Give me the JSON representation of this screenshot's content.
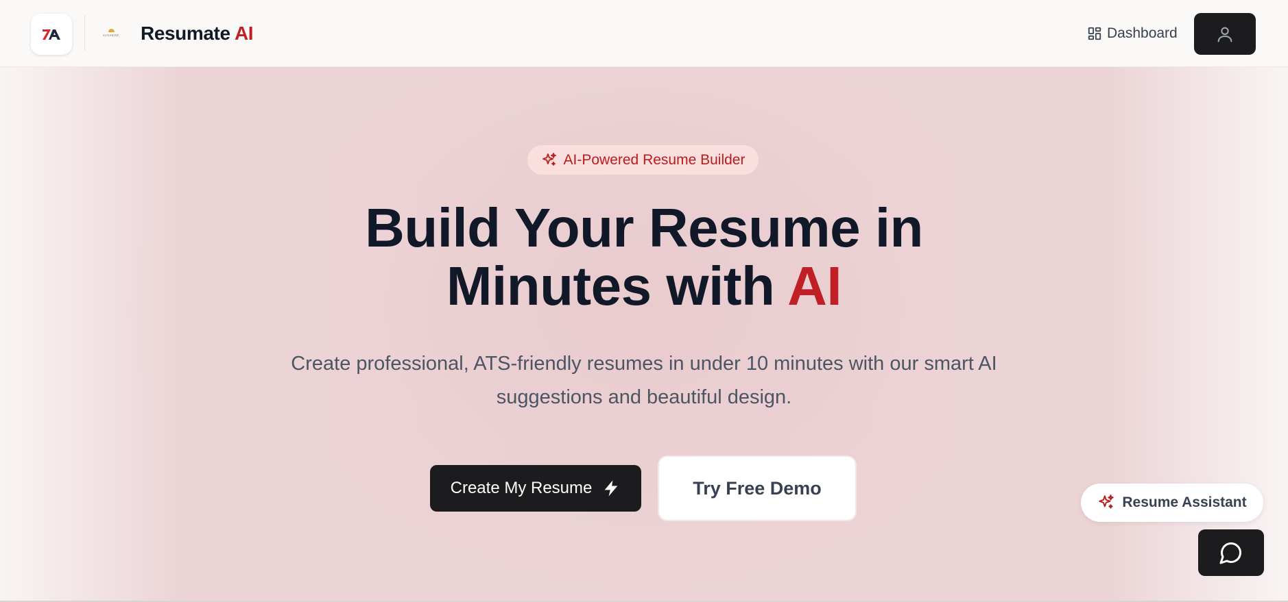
{
  "header": {
    "logo_text": "7A",
    "partner_logo_text": "SUNSHINE",
    "brand_name": "Resumate",
    "brand_accent": "AI",
    "nav_dashboard_label": "Dashboard",
    "dashboard_icon": "grid-icon",
    "profile_icon": "user-icon"
  },
  "hero": {
    "badge_icon": "sparkles-icon",
    "badge_label": "AI-Powered Resume Builder",
    "headline_line1": "Build Your Resume in",
    "headline_line2_prefix": "Minutes with",
    "headline_line2_accent": "AI",
    "subtitle": "Create professional, ATS-friendly resumes in under 10 minutes with our smart AI suggestions and beautiful design.",
    "primary_button_label": "Create My Resume",
    "primary_button_icon": "lightning-icon",
    "secondary_button_label": "Try Free Demo"
  },
  "assistant": {
    "icon": "sparkles-icon",
    "label": "Resume Assistant",
    "chat_icon": "chat-bubble-icon"
  },
  "colors": {
    "accent": "#c01f26",
    "dark": "#1c1c1e",
    "heading": "#111827",
    "body_text": "#4b5563",
    "badge_bg": "#fbdede"
  }
}
